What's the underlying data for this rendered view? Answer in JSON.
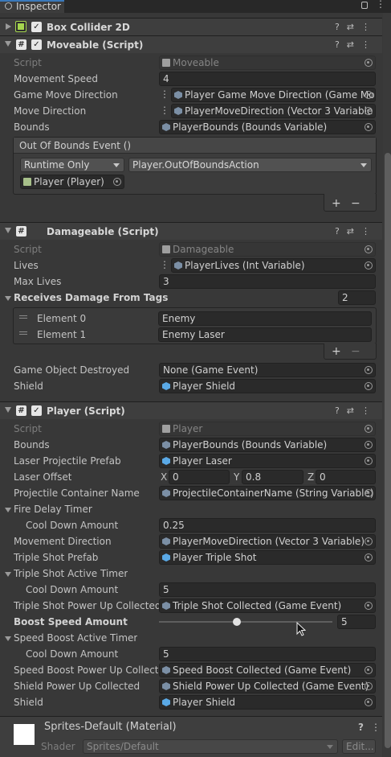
{
  "tab": {
    "title": "Inspector",
    "lock_icon": "lock-icon",
    "menu_icon": "kebab-icon"
  },
  "box_collider": {
    "title": "Box Collider 2D",
    "enabled": true
  },
  "moveable": {
    "title": "Moveable (Script)",
    "enabled": true,
    "script": {
      "label": "Script",
      "value": "Moveable"
    },
    "movement_speed": {
      "label": "Movement Speed",
      "value": "4"
    },
    "game_move_direction": {
      "label": "Game Move Direction",
      "value": "Player Game Move Direction (Game Mo"
    },
    "move_direction": {
      "label": "Move Direction",
      "value": "PlayerMoveDirection (Vector 3 Variable"
    },
    "bounds": {
      "label": "Bounds",
      "value": "PlayerBounds (Bounds Variable)"
    },
    "event": {
      "title": "Out Of Bounds Event ()",
      "runtime": "Runtime Only",
      "function": "Player.OutOfBoundsAction",
      "target": "Player (Player)"
    }
  },
  "damageable": {
    "title": "Damageable (Script)",
    "script": {
      "label": "Script",
      "value": "Damageable"
    },
    "lives": {
      "label": "Lives",
      "value": "PlayerLives (Int Variable)"
    },
    "max_lives": {
      "label": "Max Lives",
      "value": "3"
    },
    "tags": {
      "label": "Receives Damage From Tags",
      "count": "2",
      "elements": [
        {
          "label": "Element 0",
          "value": "Enemy"
        },
        {
          "label": "Element 1",
          "value": "Enemy Laser"
        }
      ]
    },
    "destroyed": {
      "label": "Game Object Destroyed",
      "value": "None (Game Event)"
    },
    "shield": {
      "label": "Shield",
      "value": "Player Shield"
    }
  },
  "player": {
    "title": "Player (Script)",
    "enabled": true,
    "script": {
      "label": "Script",
      "value": "Player"
    },
    "bounds": {
      "label": "Bounds",
      "value": "PlayerBounds (Bounds Variable)"
    },
    "laser_prefab": {
      "label": "Laser Projectile Prefab",
      "value": "Player Laser"
    },
    "laser_offset": {
      "label": "Laser Offset",
      "x_label": "X",
      "x": "0",
      "y_label": "Y",
      "y": "0.8",
      "z_label": "Z",
      "z": "0"
    },
    "container_name": {
      "label": "Projectile Container Name",
      "value": "ProjectileContainerName (String Variable)"
    },
    "fire_delay": {
      "label": "Fire Delay Timer",
      "cooldown_label": "Cool Down Amount",
      "cooldown": "0.25"
    },
    "movement_direction": {
      "label": "Movement Direction",
      "value": "PlayerMoveDirection (Vector 3 Variable)"
    },
    "triple_prefab": {
      "label": "Triple Shot Prefab",
      "value": "Player Triple Shot"
    },
    "triple_timer": {
      "label": "Triple Shot Active Timer",
      "cooldown_label": "Cool Down Amount",
      "cooldown": "5"
    },
    "triple_collected": {
      "label": "Triple Shot Power Up Collected",
      "value": "Triple Shot Collected (Game Event)"
    },
    "boost_speed": {
      "label": "Boost Speed Amount",
      "value": "5",
      "slider_fraction": 0.45
    },
    "speed_timer": {
      "label": "Speed Boost Active Timer",
      "cooldown_label": "Cool Down Amount",
      "cooldown": "5"
    },
    "speed_collected": {
      "label": "Speed Boost Power Up Collecte",
      "value": "Speed Boost Collected (Game Event)"
    },
    "shield_collected": {
      "label": "Shield Power Up Collected",
      "value": "Shield Power Up Collected (Game Event)"
    },
    "shield": {
      "label": "Shield",
      "value": "Player Shield"
    }
  },
  "material": {
    "title": "Sprites-Default (Material)",
    "shader_label": "Shader",
    "shader": "Sprites/Default",
    "edit": "Edit..."
  },
  "colors": {
    "background": "#383838",
    "field": "#2a2a2a",
    "header": "#3e3e3e",
    "object_icon": "#5aa9e6"
  }
}
